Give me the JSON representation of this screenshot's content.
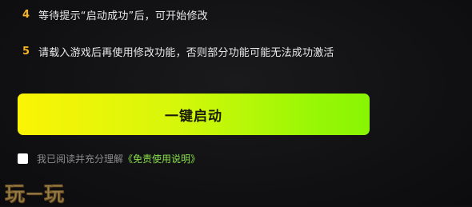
{
  "steps": [
    {
      "num": "4",
      "text": "等待提示“启动成功”后，可开始修改"
    },
    {
      "num": "5",
      "text": "请载入游戏后再使用修改功能，否则部分功能可能无法成功激活"
    }
  ],
  "launch_button": {
    "label": "一键启动"
  },
  "agreement": {
    "prefix": "我已阅读并充分理解",
    "link": "《免责使用说明》"
  },
  "watermark": {
    "text_left": "玩",
    "dash": "一",
    "text_right": "玩"
  },
  "colors": {
    "step_number": "#f5b321",
    "button_gradient_start": "#fbf406",
    "button_gradient_end": "#88f503",
    "link": "#89e04a"
  }
}
